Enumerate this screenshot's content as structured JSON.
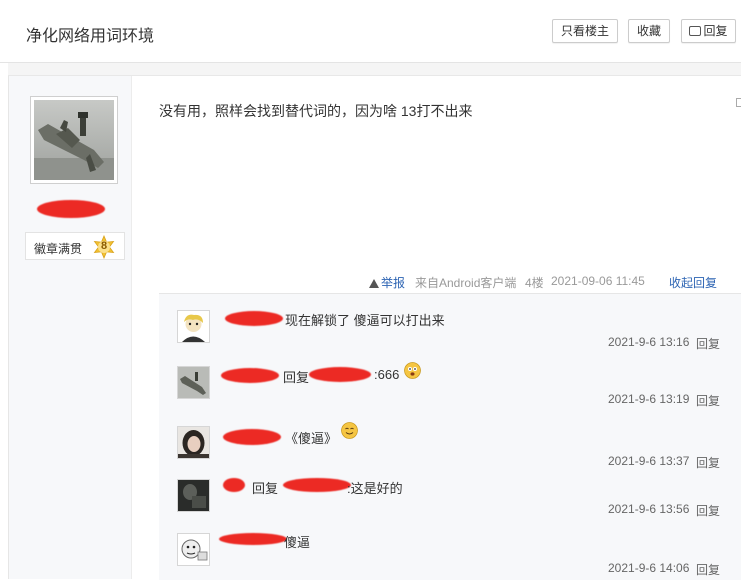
{
  "header": {
    "title": "净化网络用词环境",
    "only_author_label": "只看楼主",
    "favorite_label": "收藏",
    "reply_label": "回复"
  },
  "post": {
    "badge_label": "徽章满贯",
    "badge_level": "8",
    "content": "没有用，照样会找到替代词的，因为啥 13打不出来",
    "meta": {
      "report_label": "举报",
      "source": "来自Android客户端",
      "floor": "4楼",
      "time": "2021-09-06 11:45",
      "collapse_label": "收起回复"
    }
  },
  "comments": [
    {
      "text": "现在解锁了 傻逼可以打出来",
      "time": "2021-9-6 13:16",
      "reply_label": "回复"
    },
    {
      "reply_prefix": "回复",
      "text": ":666",
      "time": "2021-9-6 13:19",
      "reply_label": "回复"
    },
    {
      "text": "《傻逼》",
      "time": "2021-9-6 13:37",
      "reply_label": "回复"
    },
    {
      "reply_prefix": "回复",
      "text": ":这是好的",
      "time": "2021-9-6 13:56",
      "reply_label": "回复"
    },
    {
      "text": "傻逼",
      "time": "2021-9-6 14:06",
      "reply_label": "回复"
    }
  ],
  "icons": [
    "report-icon",
    "reply-icon",
    "badge-star-icon",
    "emoji-icon"
  ],
  "colors": {
    "link": "#2d64b3",
    "redaction": "#ec2a24",
    "badge": "#f2c233",
    "panel": "#f7f8fa"
  }
}
